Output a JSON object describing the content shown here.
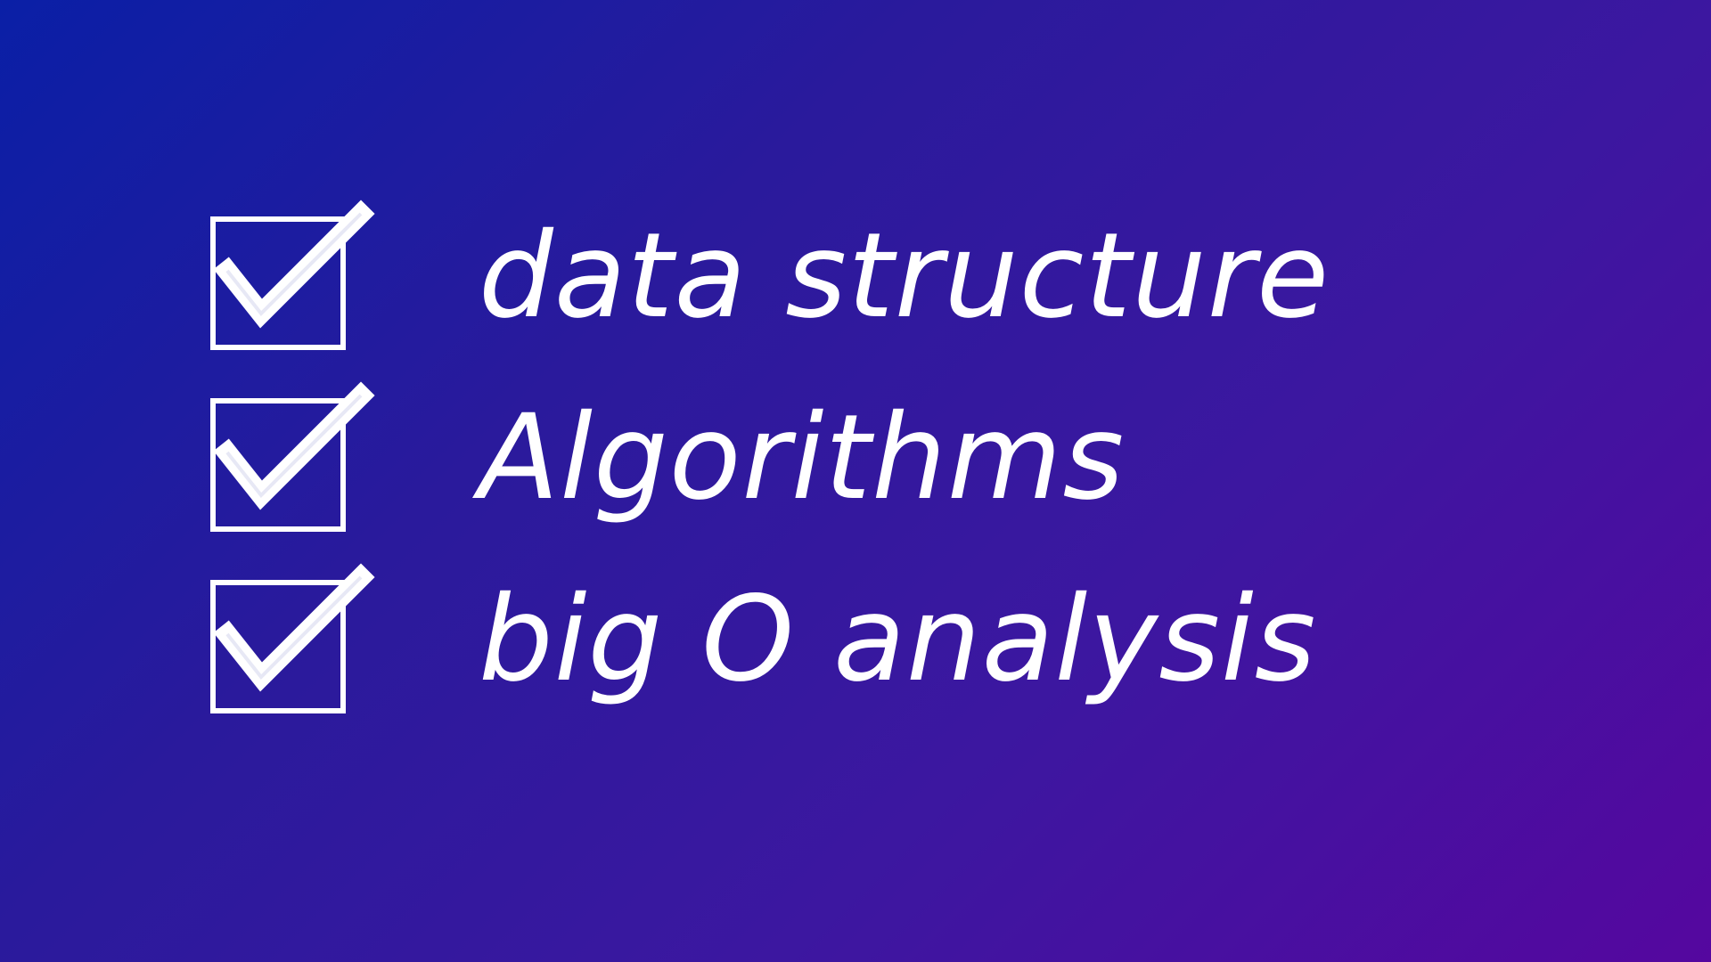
{
  "checklist": {
    "items": [
      {
        "label": "data structure",
        "checked": true,
        "icon": "checked-box-icon"
      },
      {
        "label": "Algorithms",
        "checked": true,
        "icon": "checked-box-icon"
      },
      {
        "label": "big O analysis",
        "checked": true,
        "icon": "checked-box-icon"
      }
    ]
  },
  "colors": {
    "background_start": "#0a1fa6",
    "background_end": "#55079f",
    "foreground": "#ffffff"
  }
}
